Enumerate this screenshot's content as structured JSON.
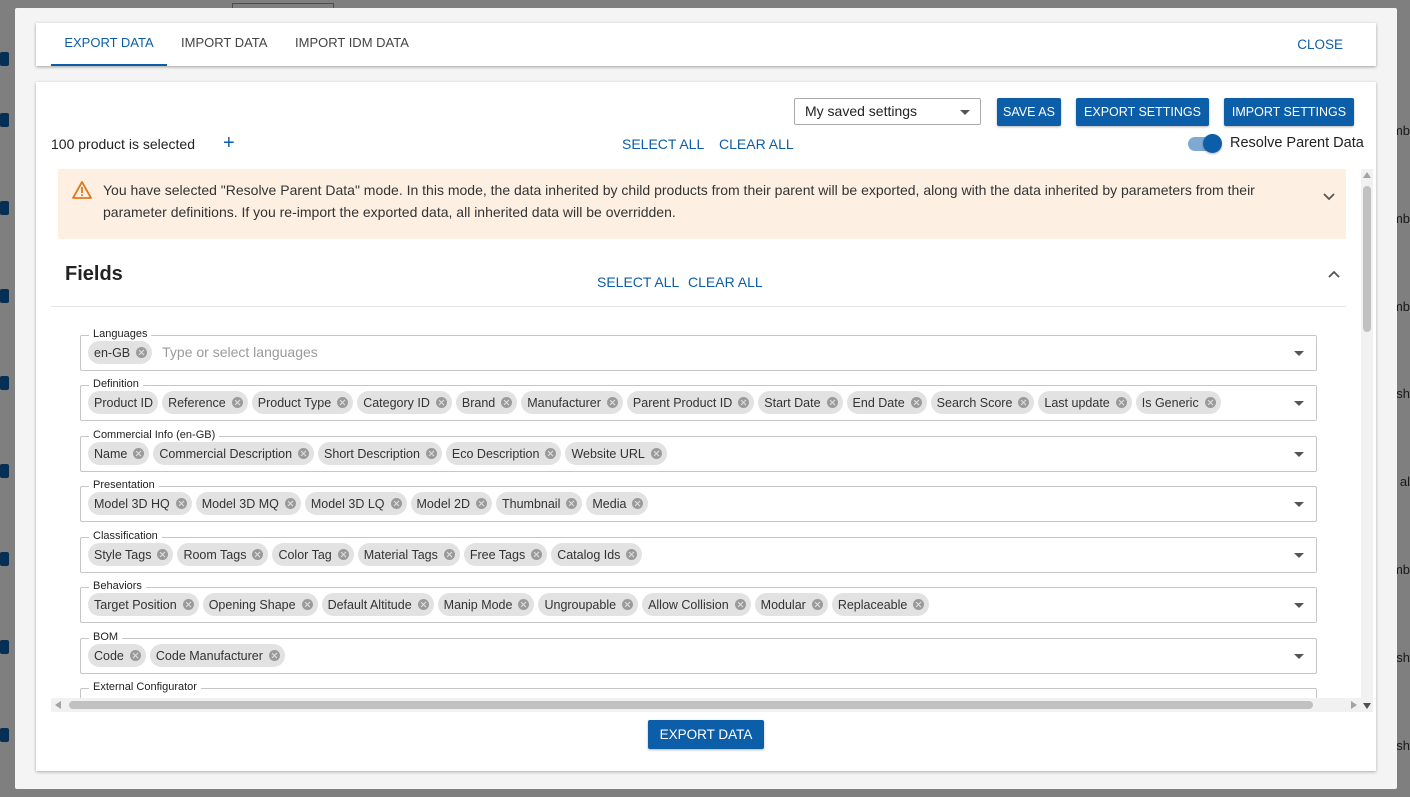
{
  "background": {
    "right_snippets": [
      "mb",
      "mb",
      "mb",
      "sh",
      "al",
      "mb",
      "sh",
      "sh"
    ]
  },
  "tabs": [
    {
      "label": "EXPORT DATA",
      "active": true
    },
    {
      "label": "IMPORT DATA",
      "active": false
    },
    {
      "label": "IMPORT IDM DATA",
      "active": false
    }
  ],
  "close_label": "CLOSE",
  "settings": {
    "saved_select_value": "My saved settings",
    "save_as_label": "SAVE AS",
    "export_settings_label": "EXPORT SETTINGS",
    "import_settings_label": "IMPORT SETTINGS"
  },
  "selection": {
    "count_text": "100 product is selected",
    "add_icon": "+",
    "select_all_label": "SELECT ALL",
    "clear_all_label": "CLEAR ALL",
    "resolve_toggle_label": "Resolve Parent Data",
    "resolve_toggle_on": true
  },
  "warning": {
    "text": "You have selected \"Resolve Parent Data\" mode. In this mode, the data inherited by child products from their parent will be exported, along with the data inherited by parameters from their parameter definitions. If you re-import the exported data, all inherited data will be overridden."
  },
  "fields_section": {
    "title": "Fields",
    "select_all_label": "SELECT ALL",
    "clear_all_label": "CLEAR ALL",
    "groups": [
      {
        "label": "Languages",
        "chips": [
          "en-GB"
        ],
        "placeholder": "Type or select languages"
      },
      {
        "label": "Definition",
        "chips": [
          "Product ID",
          "Reference",
          "Product Type",
          "Category ID",
          "Brand",
          "Manufacturer",
          "Parent Product ID",
          "Start Date",
          "End Date",
          "Search Score",
          "Last update",
          "Is Generic"
        ]
      },
      {
        "label": "Commercial Info (en-GB)",
        "chips": [
          "Name",
          "Commercial Description",
          "Short Description",
          "Eco Description",
          "Website URL"
        ]
      },
      {
        "label": "Presentation",
        "chips": [
          "Model 3D HQ",
          "Model 3D MQ",
          "Model 3D LQ",
          "Model 2D",
          "Thumbnail",
          "Media"
        ]
      },
      {
        "label": "Classification",
        "chips": [
          "Style Tags",
          "Room Tags",
          "Color Tag",
          "Material Tags",
          "Free Tags",
          "Catalog Ids"
        ]
      },
      {
        "label": "Behaviors",
        "chips": [
          "Target Position",
          "Opening Shape",
          "Default Altitude",
          "Manip Mode",
          "Ungroupable",
          "Allow Collision",
          "Modular",
          "Replaceable"
        ]
      },
      {
        "label": "BOM",
        "chips": [
          "Code",
          "Code Manufacturer"
        ]
      },
      {
        "label": "External Configurator",
        "chips": []
      }
    ]
  },
  "export_button_label": "EXPORT DATA",
  "colors": {
    "accent": "#0d5ea8",
    "warning_bg": "#fdf0e3",
    "warning_icon": "#e0781f",
    "chip_bg": "#e2e2e2"
  }
}
